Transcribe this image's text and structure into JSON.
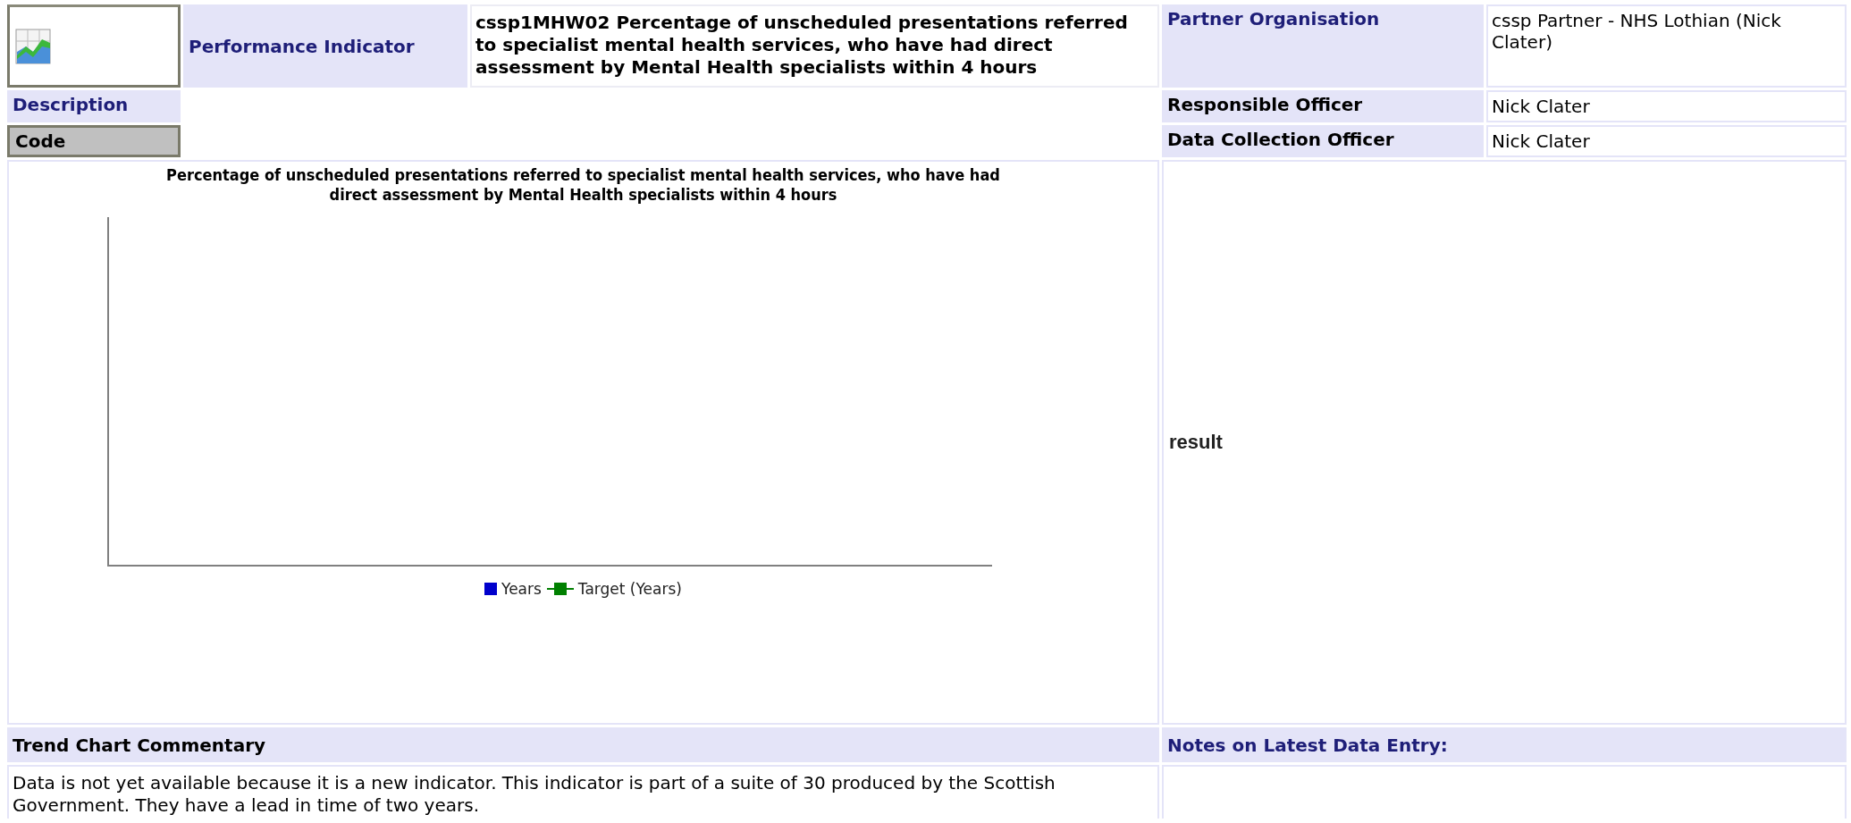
{
  "header": {
    "label": "Performance Indicator",
    "title": "cssp1MHW02 Percentage of unscheduled presentations referred to specialist mental health services, who have had direct assessment by Mental Health specialists within 4 hours"
  },
  "left_labels": [
    {
      "text": "Description",
      "kind": "link"
    },
    {
      "text": "Code",
      "kind": "button"
    }
  ],
  "fields": [
    {
      "label": "Partner Organisation",
      "kind": "link",
      "value": "cssp Partner - NHS Lothian (Nick Clater)"
    },
    {
      "label": "Responsible Officer",
      "kind": "plain",
      "value": "Nick Clater"
    },
    {
      "label": "Data Collection Officer",
      "kind": "plain",
      "value": "Nick Clater"
    }
  ],
  "chart": {
    "title": "Percentage of unscheduled presentations referred to specialist mental health services, who have had direct assessment by Mental Health specialists within 4 hours",
    "legend": [
      {
        "label": "Years",
        "kind": "box",
        "color": "#0000cc"
      },
      {
        "label": "Target (Years)",
        "kind": "line",
        "color": "#008000"
      }
    ]
  },
  "result": {
    "label": "result"
  },
  "commentary": {
    "label": "Trend Chart Commentary",
    "text": "Data is not yet available because it is a new indicator. This indicator is part of a suite of 30 produced by the Scottish Government. They have a lead in time of two years."
  },
  "notes": {
    "label": "Notes on Latest Data Entry:"
  }
}
